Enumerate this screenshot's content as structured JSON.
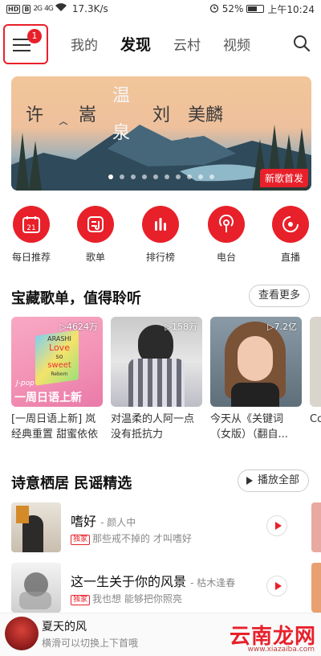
{
  "status": {
    "left_chips": [
      "HD",
      "B"
    ],
    "signal1": "2G",
    "signal2": "4G",
    "speed": "17.3K/s",
    "battery": "52%",
    "time": "上午10:24"
  },
  "nav": {
    "menu_badge": "1",
    "tabs": [
      "我的",
      "发现",
      "云村",
      "视频"
    ],
    "active_tab": "发现"
  },
  "banner": {
    "title_chars": [
      "许",
      "嵩",
      "温",
      "泉",
      "刘",
      "美麟"
    ],
    "tag": "新歌首发"
  },
  "quick_icons": [
    {
      "label": "每日推荐",
      "icon": "calendar-icon",
      "text": "21"
    },
    {
      "label": "歌单",
      "icon": "playlist-icon",
      "text": ""
    },
    {
      "label": "排行榜",
      "icon": "chart-bars-icon",
      "text": ""
    },
    {
      "label": "电台",
      "icon": "radio-icon",
      "text": ""
    },
    {
      "label": "直播",
      "icon": "live-icon",
      "text": ""
    }
  ],
  "treasure": {
    "title": "宝藏歌单，值得聆听",
    "more": "查看更多",
    "cards": [
      {
        "plays": "▷4624万",
        "title": "[一周日语上新] 岚经典重置 甜蜜依依然",
        "cover_text": "一周日语上新",
        "cover_small": "J-pop",
        "cover_lines": [
          "ARASHI",
          "Love",
          "so",
          "sweet",
          "Reborn"
        ]
      },
      {
        "plays": "▷158万",
        "title": "对温柔的人阿一点没有抵抗力"
      },
      {
        "plays": "▷7.2亿",
        "title": "今天从《关键词（女版）（翻自..."
      },
      {
        "plays": "",
        "title": "Co"
      }
    ]
  },
  "folk": {
    "title": "诗意栖居 民谣精选",
    "play_all": "播放全部",
    "songs": [
      {
        "name": "嗜好",
        "artist": "- 颜人中",
        "badge": "独家",
        "sub": "那些戒不掉的 才叫嗜好"
      },
      {
        "name": "这一生关于你的风景",
        "artist": "- 枯木逢春",
        "badge": "独家",
        "sub": "我也想 能够把你照亮"
      }
    ]
  },
  "mini_player": {
    "title": "夏天的风",
    "sub": "横滑可以切换上下首哦",
    "watermark": "云南龙网",
    "watermark_sub": "www.xiazaiba.com"
  },
  "colors": {
    "accent": "#e8202a"
  }
}
